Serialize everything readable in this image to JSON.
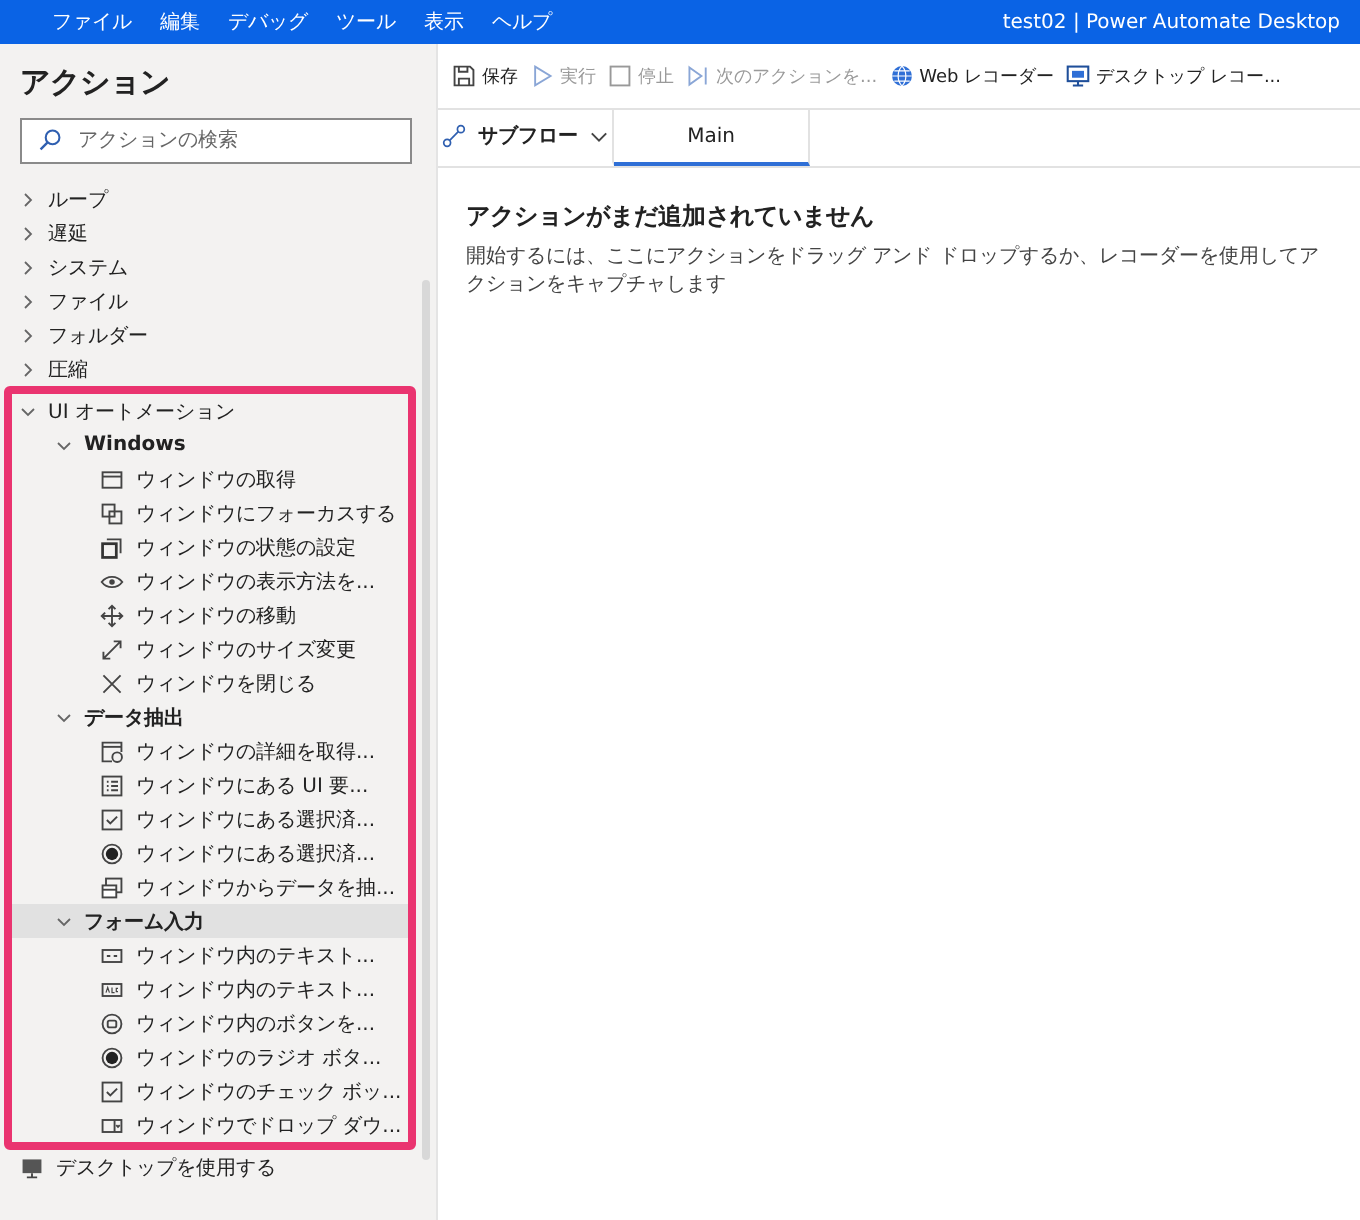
{
  "title_bar": {
    "menu": [
      "ファイル",
      "編集",
      "デバッグ",
      "ツール",
      "表示",
      "ヘルプ"
    ],
    "title": "test02 | Power Automate Desktop"
  },
  "sidebar": {
    "title": "アクション",
    "search": {
      "placeholder": "アクションの検索"
    },
    "tree": [
      {
        "label": "ループ",
        "expanded": false,
        "selected": false,
        "framed": false
      },
      {
        "label": "遅延",
        "expanded": false,
        "selected": false,
        "framed": false
      },
      {
        "label": "システム",
        "expanded": false,
        "selected": false,
        "framed": false
      },
      {
        "label": "ファイル",
        "expanded": false,
        "selected": false,
        "framed": false
      },
      {
        "label": "フォルダー",
        "expanded": false,
        "selected": false,
        "framed": false
      },
      {
        "label": "圧縮",
        "expanded": false,
        "selected": false,
        "framed": false
      },
      {
        "label": "UI オートメーション",
        "expanded": true,
        "selected": false,
        "framed": true,
        "children": [
          {
            "label": "Windows",
            "expanded": true,
            "selected": false,
            "children": [
              {
                "label": "ウィンドウの取得",
                "kind": "window",
                "selected": false
              },
              {
                "label": "ウィンドウにフォーカスする",
                "kind": "focus",
                "selected": false
              },
              {
                "label": "ウィンドウの状態の設定",
                "kind": "state",
                "selected": false
              },
              {
                "label": "ウィンドウの表示方法を...",
                "kind": "eye",
                "selected": false
              },
              {
                "label": "ウィンドウの移動",
                "kind": "move",
                "selected": false
              },
              {
                "label": "ウィンドウのサイズ変更",
                "kind": "resize",
                "selected": false
              },
              {
                "label": "ウィンドウを閉じる",
                "kind": "close",
                "selected": false
              }
            ]
          },
          {
            "label": "データ抽出",
            "expanded": true,
            "selected": false,
            "children": [
              {
                "label": "ウィンドウの詳細を取得...",
                "kind": "details",
                "selected": false
              },
              {
                "label": "ウィンドウにある UI 要...",
                "kind": "list",
                "selected": false
              },
              {
                "label": "ウィンドウにある選択済...",
                "kind": "checkbox",
                "selected": false
              },
              {
                "label": "ウィンドウにある選択済...",
                "kind": "radio",
                "selected": false
              },
              {
                "label": "ウィンドウからデータを抽...",
                "kind": "extract",
                "selected": false
              }
            ]
          },
          {
            "label": "フォーム入力",
            "expanded": true,
            "selected": true,
            "children": [
              {
                "label": "ウィンドウ内のテキスト...",
                "kind": "textfield",
                "selected": false
              },
              {
                "label": "ウィンドウ内のテキスト...",
                "kind": "abc",
                "selected": false
              },
              {
                "label": "ウィンドウ内のボタンを...",
                "kind": "button",
                "selected": false
              },
              {
                "label": "ウィンドウのラジオ ボタ...",
                "kind": "radio",
                "selected": false
              },
              {
                "label": "ウィンドウのチェック ボッ...",
                "kind": "checkbox",
                "selected": false
              },
              {
                "label": "ウィンドウでドロップ ダウ...",
                "kind": "dropdown",
                "selected": false
              }
            ]
          }
        ]
      },
      {
        "label": "デスクトップを使用する",
        "kind": "desktop",
        "selected": false,
        "framed": false
      }
    ]
  },
  "toolbar": [
    {
      "label": "保存",
      "kind": "save",
      "disabled": false
    },
    {
      "label": "実行",
      "kind": "play",
      "disabled": true
    },
    {
      "label": "停止",
      "kind": "stop",
      "disabled": true
    },
    {
      "label": "次のアクションを...",
      "kind": "step",
      "disabled": true
    },
    {
      "label": "Web レコーダー",
      "kind": "globe",
      "disabled": false
    },
    {
      "label": "デスクトップ レコー...",
      "kind": "monitor",
      "disabled": false
    }
  ],
  "tabs": [
    {
      "label": "サブフロー",
      "kind": "dropdown",
      "selected": false
    },
    {
      "label": "Main",
      "kind": "tab",
      "selected": true
    }
  ],
  "canvas": {
    "heading": "アクションがまだ追加されていません",
    "description": "開始するには、ここにアクションをドラッグ アンド ドロップするか、レコーダーを使用してアクションをキャプチャします"
  }
}
